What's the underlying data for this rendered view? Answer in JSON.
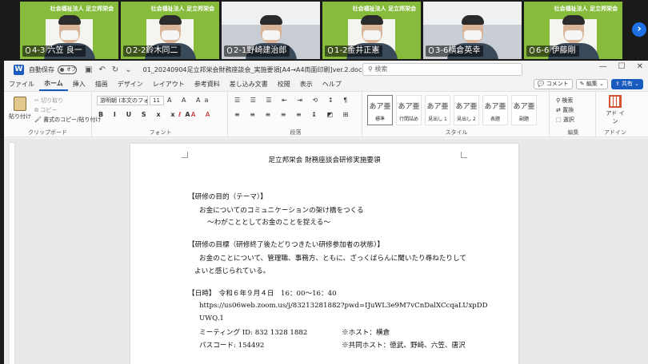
{
  "participants": [
    {
      "name": "4-3 六笠 良一",
      "banner": "社会福祉法人 足立邦栄会",
      "bg": "logo",
      "active": false
    },
    {
      "name": "2-2鈴木同二",
      "banner": "社会福祉法人 足立邦栄会",
      "bg": "logo",
      "active": false
    },
    {
      "name": "2-1野崎建治郎",
      "banner": "",
      "bg": "office",
      "active": true
    },
    {
      "name": "1-2金井正憲",
      "banner": "社会福祉法人 足立邦栄会",
      "bg": "logo",
      "active": false
    },
    {
      "name": "3-6横倉英幸",
      "banner": "",
      "bg": "office",
      "active": false
    },
    {
      "name": "6-6 伊藤剛",
      "banner": "社会福祉法人 足立邦栄会",
      "bg": "logo",
      "active": false
    }
  ],
  "next_arrow": "›",
  "word": {
    "autosave_label": "自動保存",
    "autosave_state": "オフ",
    "doc_title": "01_20240904足立邦栄会財務座談会_実施要領[A4→A4両面印刷]ver.2.docx • 保存済み ∨",
    "search_placeholder": "検索",
    "menu": [
      "ファイル",
      "ホーム",
      "挿入",
      "描画",
      "デザイン",
      "レイアウト",
      "参考資料",
      "差し込み文書",
      "校閲",
      "表示",
      "ヘルプ"
    ],
    "menu_selected": "ホーム",
    "comment_label": "コメント",
    "edit_label": "編集",
    "share_label": "共有",
    "ribbon": {
      "paste": "貼り付け",
      "cut": "切り取り",
      "copy": "コピー",
      "format_painter": "書式のコピー/貼り付け",
      "clipboard": "クリップボード",
      "font_name": "游明朝 (本文のフォント",
      "font_size": "11",
      "font_group": "フォント",
      "paragraph_group": "段落",
      "style_group": "スタイル",
      "edit_group": "編集",
      "addin_group": "アドイン",
      "styles": [
        {
          "preview": "あア亜",
          "name": "標準"
        },
        {
          "preview": "あア亜",
          "name": "行間詰め"
        },
        {
          "preview": "あア亜",
          "name": "見出し 1"
        },
        {
          "preview": "あア亜",
          "name": "見出し 2"
        },
        {
          "preview": "あア亜",
          "name": "表題"
        },
        {
          "preview": "あア亜",
          "name": "副題"
        }
      ],
      "find": "検索",
      "replace": "置換",
      "select": "選択",
      "addin": "アド イン"
    },
    "document": {
      "title": "足立邦栄会 財務座談会研修実施要領",
      "lines": [
        "【研修の目的（テーマ）】",
        "お金についてのコミュニケーションの架け橋をつくる",
        "～わがこととしてお金のことを捉える～",
        "【研修の目標（研修終了後たどりつきたい研修参加者の状態）】",
        "お金のことについて、管理職、事務方、ともに、ざっくばらんに聞いたり尋ねたりして",
        "よいと感じられている。",
        "【日時】　令和６年９月４日　16：00～16：40",
        "https://us06web.zoom.us/j/83213281882?pwd=IJuWL3e9M7vCnDalXCcqaLUxpDD",
        "UWQ.1",
        "ミーティング ID: 832 1328 1882",
        "※ホスト：横倉",
        "パスコード: 154492",
        "※共同ホスト：徳武、野崎、六笠、唐沢"
      ]
    }
  }
}
